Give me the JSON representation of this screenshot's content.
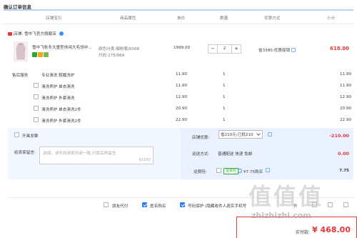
{
  "page": {
    "title": "确认订单信息"
  },
  "table_headers": [
    "店铺宝贝",
    "商品属性",
    "单价",
    "数量",
    "优惠方式",
    "小计"
  ],
  "shop": {
    "label": "店铺:",
    "name": "雪中飞官方旗舰店"
  },
  "product": {
    "title": "雪中飞秋冬大童型休闲大毛领中...",
    "color": "颜色分类:烟粉紫|6098",
    "size": "尺码:175/96A",
    "price": "1999.00",
    "qty": "2",
    "minus": "−",
    "plus": "+",
    "promo": "省3380:优惠促销",
    "subtotal": "618.00"
  },
  "after_sales": {
    "label": "售后服务",
    "items": [
      {
        "name": "专业清洗 鞋履洗护",
        "price": "11.90",
        "qty": "1",
        "total": "11.90",
        "has_checkbox": false
      },
      {
        "name": "清洗养护 单衣清洗",
        "price": "11.90",
        "qty": "1",
        "total": "11.90",
        "has_checkbox": true
      },
      {
        "name": "清洗养护 外套清洗",
        "price": "12.90",
        "qty": "1",
        "total": "12.90",
        "has_checkbox": true
      },
      {
        "name": "清洗养护 单衣清洗2件",
        "price": "20.90",
        "qty": "1",
        "total": "20.90",
        "has_checkbox": true
      },
      {
        "name": "清洗养护 外套清洗2件",
        "price": "22.90",
        "qty": "1",
        "total": "22.90",
        "has_checkbox": true
      }
    ]
  },
  "invoice": {
    "label": "开具发票"
  },
  "shop_discount": {
    "label": "店铺优惠:",
    "value": "省210元:已抵210",
    "amount": "-210.00"
  },
  "shipping": {
    "label": "运送方式:",
    "value": "普通配送 快递 免邮",
    "amount": "0.00"
  },
  "insurance": {
    "label": "运费险:",
    "badge": "运费险",
    "value": "¥7.75购买",
    "amount": "7.75"
  },
  "message": {
    "label": "给卖家留言:",
    "placeholder": "选填。请先和商家协商一致,付款后再留言",
    "counter": "0/200"
  },
  "footer_options": {
    "friend_pay": "朋友代付",
    "anonymous": "匿名购买",
    "privacy": "号码保护 (隐藏收件人真实手机号",
    "checkout_hint": "升"
  },
  "total": {
    "label": "实付款:",
    "amount": "¥ 468.00"
  },
  "watermark": {
    "text": "值值值",
    "url": "zhizhizhi.com"
  },
  "colors": {
    "accent": "#e4393c",
    "blue": "#2a7fff",
    "green": "#2fa832",
    "panel": "#f2f7ff"
  }
}
